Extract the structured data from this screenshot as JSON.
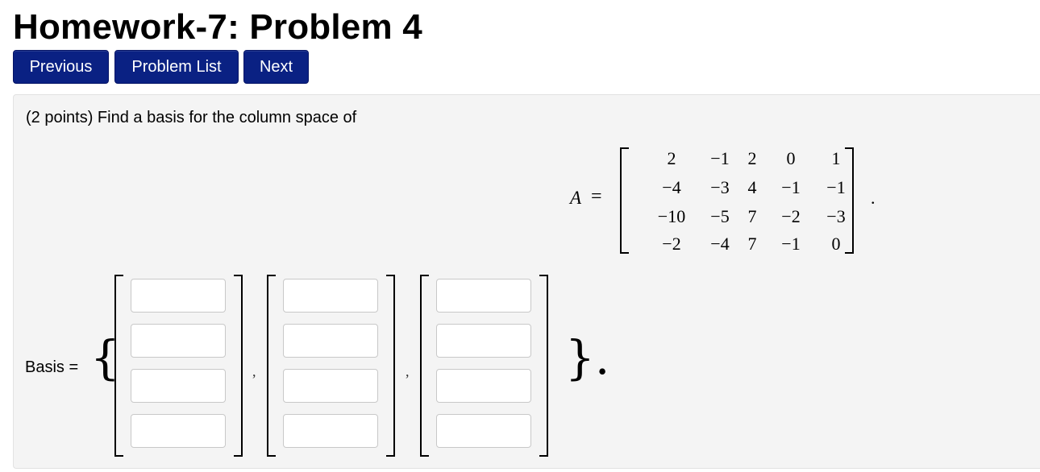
{
  "header": {
    "title": "Homework-7: Problem 4"
  },
  "nav": {
    "previous_label": "Previous",
    "problem_list_label": "Problem List",
    "next_label": "Next"
  },
  "problem": {
    "statement": "(2 points) Find a basis for the column space of",
    "matrix_name": "A",
    "equals": "=",
    "matrix": [
      [
        "2",
        "−1",
        "2",
        "0",
        "1"
      ],
      [
        "−4",
        "−3",
        "4",
        "−1",
        "−1"
      ],
      [
        "−10",
        "−5",
        "7",
        "−2",
        "−3"
      ],
      [
        "−2",
        "−4",
        "7",
        "−1",
        "0"
      ]
    ],
    "matrix_end": ".",
    "basis_label": "Basis =",
    "basis_open": "{",
    "basis_close": "}.",
    "separator": ",",
    "answer_vectors": [
      [
        "",
        "",
        "",
        ""
      ],
      [
        "",
        "",
        "",
        ""
      ],
      [
        "",
        "",
        "",
        ""
      ]
    ]
  }
}
